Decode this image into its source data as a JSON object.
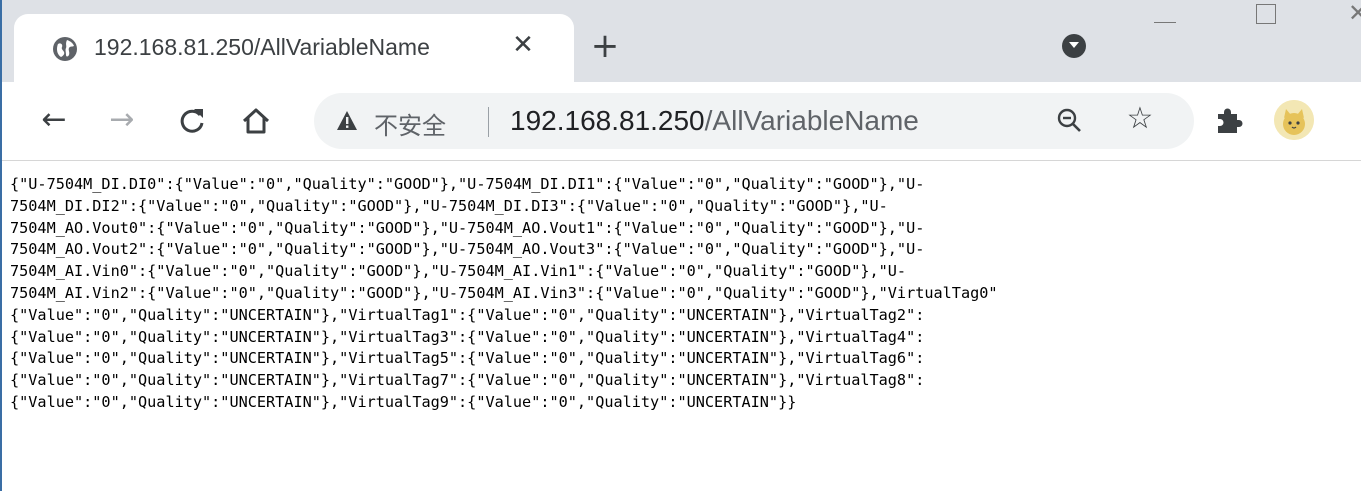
{
  "tab": {
    "title": "192.168.81.250/AllVariableName",
    "close_glyph": "✕",
    "icon": "globe-icon"
  },
  "new_tab_glyph": "+",
  "window_controls": {
    "minimize": "minimize-icon",
    "maximize": "maximize-icon",
    "close": "close-icon"
  },
  "toolbar": {
    "back_glyph": "←",
    "forward_glyph": "→",
    "reload_glyph": "C",
    "home_glyph": "⌂",
    "security_label": "不安全",
    "url_host": "192.168.81.250",
    "url_path": "/AllVariableName",
    "star_glyph": "☆"
  },
  "colors": {
    "tabstrip": "#dee1e6",
    "omnibox": "#f1f3f4",
    "text": "#000000"
  },
  "content": {
    "lines": [
      "{\"U-7504M_DI.DI0\":{\"Value\":\"0\",\"Quality\":\"GOOD\"},\"U-7504M_DI.DI1\":{\"Value\":\"0\",\"Quality\":\"GOOD\"},\"U-",
      "7504M_DI.DI2\":{\"Value\":\"0\",\"Quality\":\"GOOD\"},\"U-7504M_DI.DI3\":{\"Value\":\"0\",\"Quality\":\"GOOD\"},\"U-",
      "7504M_AO.Vout0\":{\"Value\":\"0\",\"Quality\":\"GOOD\"},\"U-7504M_AO.Vout1\":{\"Value\":\"0\",\"Quality\":\"GOOD\"},\"U-",
      "7504M_AO.Vout2\":{\"Value\":\"0\",\"Quality\":\"GOOD\"},\"U-7504M_AO.Vout3\":{\"Value\":\"0\",\"Quality\":\"GOOD\"},\"U-",
      "7504M_AI.Vin0\":{\"Value\":\"0\",\"Quality\":\"GOOD\"},\"U-7504M_AI.Vin1\":{\"Value\":\"0\",\"Quality\":\"GOOD\"},\"U-",
      "7504M_AI.Vin2\":{\"Value\":\"0\",\"Quality\":\"GOOD\"},\"U-7504M_AI.Vin3\":{\"Value\":\"0\",\"Quality\":\"GOOD\"},\"VirtualTag0\"",
      "{\"Value\":\"0\",\"Quality\":\"UNCERTAIN\"},\"VirtualTag1\":{\"Value\":\"0\",\"Quality\":\"UNCERTAIN\"},\"VirtualTag2\":",
      "{\"Value\":\"0\",\"Quality\":\"UNCERTAIN\"},\"VirtualTag3\":{\"Value\":\"0\",\"Quality\":\"UNCERTAIN\"},\"VirtualTag4\":",
      "{\"Value\":\"0\",\"Quality\":\"UNCERTAIN\"},\"VirtualTag5\":{\"Value\":\"0\",\"Quality\":\"UNCERTAIN\"},\"VirtualTag6\":",
      "{\"Value\":\"0\",\"Quality\":\"UNCERTAIN\"},\"VirtualTag7\":{\"Value\":\"0\",\"Quality\":\"UNCERTAIN\"},\"VirtualTag8\":",
      "{\"Value\":\"0\",\"Quality\":\"UNCERTAIN\"},\"VirtualTag9\":{\"Value\":\"0\",\"Quality\":\"UNCERTAIN\"}}"
    ]
  }
}
